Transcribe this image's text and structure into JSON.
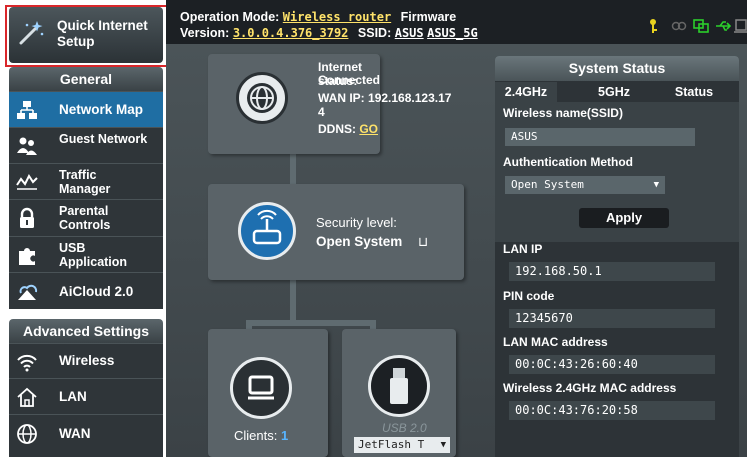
{
  "sidebar": {
    "quick_internet_setup": "Quick Internet Setup",
    "general_header": "General",
    "general_items": [
      {
        "label": "Network Map",
        "icon": "network-map-icon"
      },
      {
        "label": "Guest Network",
        "icon": "guest-network-icon"
      },
      {
        "label": "Traffic Manager",
        "icon": "traffic-manager-icon"
      },
      {
        "label": "Parental Controls",
        "icon": "parental-controls-icon"
      },
      {
        "label": "USB Application",
        "icon": "usb-application-icon"
      },
      {
        "label": "AiCloud 2.0",
        "icon": "aicloud-icon"
      }
    ],
    "advanced_header": "Advanced Settings",
    "advanced_items": [
      {
        "label": "Wireless",
        "icon": "wireless-icon"
      },
      {
        "label": "LAN",
        "icon": "lan-icon"
      },
      {
        "label": "WAN",
        "icon": "wan-icon"
      }
    ]
  },
  "topbar": {
    "operation_mode_label": "Operation Mode:",
    "operation_mode_value": "Wireless router",
    "firmware_label": "Firmware",
    "version_label": "Version:",
    "version_value": "3.0.0.4.376_3792",
    "ssid_label": "SSID:",
    "ssid_values": [
      "ASUS",
      "ASUS_5G"
    ]
  },
  "network_map": {
    "internet_status_label": "Internet status:",
    "internet_status_value": "Connected",
    "wan_ip_label": "WAN IP:",
    "wan_ip_value": "192.168.123.17",
    "wan_ip_wrap": "4",
    "ddns_label": "DDNS:",
    "ddns_link": "GO",
    "security_level_label": "Security level:",
    "security_level_value": "Open System",
    "clients_label": "Clients:",
    "clients_count": "1",
    "usb_label": "USB 2.0",
    "usb_device": "JetFlash T"
  },
  "system_status": {
    "title": "System Status",
    "tabs": [
      "2.4GHz",
      "5GHz",
      "Status"
    ],
    "wireless_name_label": "Wireless name(SSID)",
    "wireless_name_value": "ASUS",
    "auth_method_label": "Authentication Method",
    "auth_method_value": "Open System",
    "apply_label": "Apply",
    "lan_ip_label": "LAN IP",
    "lan_ip_value": "192.168.50.1",
    "pin_code_label": "PIN code",
    "pin_code_value": "12345670",
    "lan_mac_label": "LAN MAC address",
    "lan_mac_value": "00:0C:43:26:60:40",
    "wireless_mac_label": "Wireless 2.4GHz MAC address",
    "wireless_mac_value": "00:0C:43:76:20:58"
  },
  "colors": {
    "active_menu": "#1f6ea3",
    "highlight_outline": "#d9262a",
    "link_yellow": "#ffe36a",
    "link_blue": "#58b5ff"
  }
}
